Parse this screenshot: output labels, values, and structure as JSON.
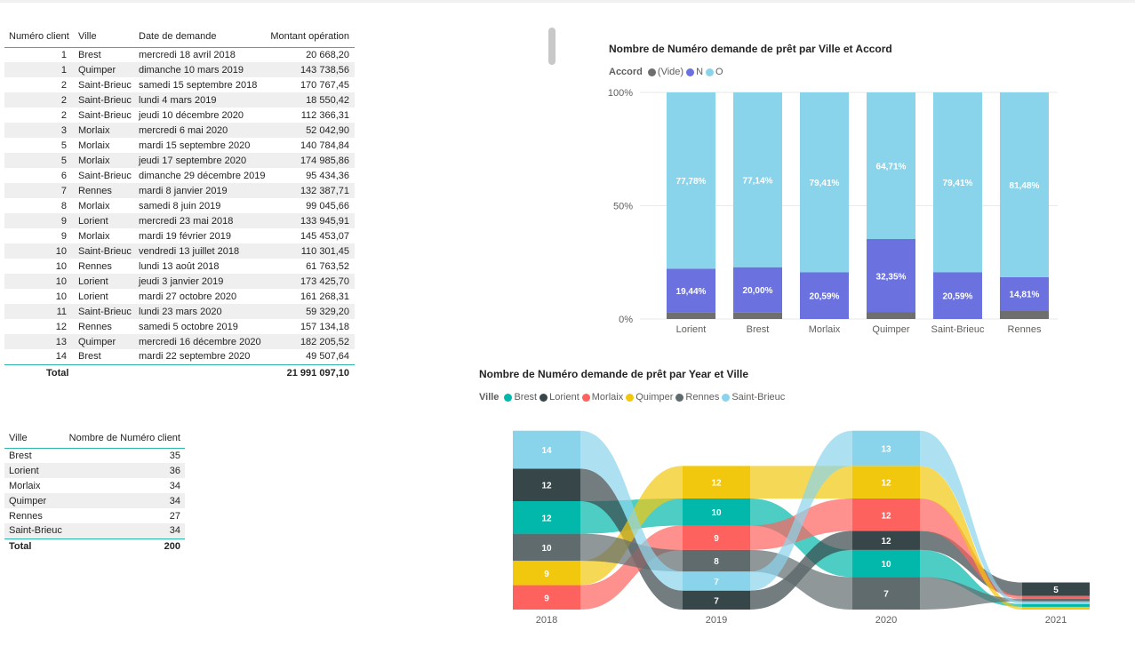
{
  "loans_table": {
    "headers": [
      "Numéro client",
      "Ville",
      "Date de demande",
      "Montant opération"
    ],
    "rows": [
      [
        "1",
        "Brest",
        "mercredi 18 avril 2018",
        "20 668,20"
      ],
      [
        "1",
        "Quimper",
        "dimanche 10 mars 2019",
        "143 738,56"
      ],
      [
        "2",
        "Saint-Brieuc",
        "samedi 15 septembre 2018",
        "170 767,45"
      ],
      [
        "2",
        "Saint-Brieuc",
        "lundi 4 mars 2019",
        "18 550,42"
      ],
      [
        "2",
        "Saint-Brieuc",
        "jeudi 10 décembre 2020",
        "112 366,31"
      ],
      [
        "3",
        "Morlaix",
        "mercredi 6 mai 2020",
        "52 042,90"
      ],
      [
        "5",
        "Morlaix",
        "mardi 15 septembre 2020",
        "140 784,84"
      ],
      [
        "5",
        "Morlaix",
        "jeudi 17 septembre 2020",
        "174 985,86"
      ],
      [
        "6",
        "Saint-Brieuc",
        "dimanche 29 décembre 2019",
        "95 434,36"
      ],
      [
        "7",
        "Rennes",
        "mardi 8 janvier 2019",
        "132 387,71"
      ],
      [
        "8",
        "Morlaix",
        "samedi 8 juin 2019",
        "99 045,66"
      ],
      [
        "9",
        "Lorient",
        "mercredi 23 mai 2018",
        "133 945,91"
      ],
      [
        "9",
        "Morlaix",
        "mardi 19 février 2019",
        "145 453,07"
      ],
      [
        "10",
        "Saint-Brieuc",
        "vendredi 13 juillet 2018",
        "110 301,45"
      ],
      [
        "10",
        "Rennes",
        "lundi 13 août 2018",
        "61 763,52"
      ],
      [
        "10",
        "Lorient",
        "jeudi 3 janvier 2019",
        "173 425,70"
      ],
      [
        "10",
        "Lorient",
        "mardi 27 octobre 2020",
        "161 268,31"
      ],
      [
        "11",
        "Saint-Brieuc",
        "lundi 23 mars 2020",
        "59 329,20"
      ],
      [
        "12",
        "Rennes",
        "samedi 5 octobre 2019",
        "157 134,18"
      ],
      [
        "13",
        "Quimper",
        "mercredi 16 décembre 2020",
        "182 205,52"
      ],
      [
        "14",
        "Brest",
        "mardi 22 septembre 2020",
        "49 507,64"
      ]
    ],
    "total_label": "Total",
    "total_value": "21 991 097,10"
  },
  "ville_table": {
    "headers": [
      "Ville",
      "Nombre de Numéro client"
    ],
    "rows": [
      [
        "Brest",
        "35"
      ],
      [
        "Lorient",
        "36"
      ],
      [
        "Morlaix",
        "34"
      ],
      [
        "Quimper",
        "34"
      ],
      [
        "Rennes",
        "27"
      ],
      [
        "Saint-Brieuc",
        "34"
      ]
    ],
    "total_label": "Total",
    "total_value": "200"
  },
  "bar_chart": {
    "title": "Nombre de Numéro demande de prêt par Ville et Accord",
    "legend_title": "Accord",
    "legend": [
      {
        "label": "(Vide)",
        "color": "#6e6e6e"
      },
      {
        "label": "N",
        "color": "#6b72e0"
      },
      {
        "label": "O",
        "color": "#8ad4eb"
      }
    ],
    "y_ticks": [
      "100%",
      "50%",
      "0%"
    ]
  },
  "ribbon_chart": {
    "title": "Nombre de Numéro demande de prêt par Year et Ville",
    "legend_title": "Ville",
    "legend": [
      {
        "label": "Brest",
        "color": "#01b8aa"
      },
      {
        "label": "Lorient",
        "color": "#374649"
      },
      {
        "label": "Morlaix",
        "color": "#fd625e"
      },
      {
        "label": "Quimper",
        "color": "#f2c80f"
      },
      {
        "label": "Rennes",
        "color": "#5f6b6d"
      },
      {
        "label": "Saint-Brieuc",
        "color": "#8ad4eb"
      }
    ]
  },
  "chart_data": [
    {
      "type": "bar",
      "stacked": "100%",
      "title": "Nombre de Numéro demande de prêt par Ville et Accord",
      "categories": [
        "Lorient",
        "Brest",
        "Morlaix",
        "Quimper",
        "Saint-Brieuc",
        "Rennes"
      ],
      "series": [
        {
          "name": "(Vide)",
          "values": [
            2.78,
            2.86,
            0,
            2.94,
            0,
            3.7
          ]
        },
        {
          "name": "N",
          "values": [
            19.44,
            20.0,
            20.59,
            32.35,
            20.59,
            14.81
          ]
        },
        {
          "name": "O",
          "values": [
            77.78,
            77.14,
            79.41,
            64.71,
            79.41,
            81.48
          ]
        }
      ],
      "data_labels": {
        "N": [
          "19,44%",
          "20,00%",
          "20,59%",
          "32,35%",
          "20,59%",
          "14,81%"
        ],
        "O": [
          "77,78%",
          "77,14%",
          "79,41%",
          "64,71%",
          "79,41%",
          "81,48%"
        ]
      },
      "ylim": [
        0,
        100
      ],
      "legend_position": "top-left",
      "grid": true
    },
    {
      "type": "area",
      "subtype": "ribbon",
      "title": "Nombre de Numéro demande de prêt par Year et Ville",
      "categories": [
        "2018",
        "2019",
        "2020",
        "2021"
      ],
      "series": [
        {
          "name": "Brest",
          "values": [
            12,
            10,
            10,
            1
          ]
        },
        {
          "name": "Lorient",
          "values": [
            12,
            7,
            7,
            5
          ]
        },
        {
          "name": "Morlaix",
          "values": [
            9,
            9,
            12,
            1
          ]
        },
        {
          "name": "Quimper",
          "values": [
            9,
            12,
            12,
            1
          ]
        },
        {
          "name": "Rennes",
          "values": [
            10,
            8,
            12,
            1
          ]
        },
        {
          "name": "Saint-Brieuc",
          "values": [
            14,
            7,
            13,
            1
          ]
        }
      ],
      "stack_order_bottom_to_top": [
        [
          "Morlaix",
          "Quimper",
          "Rennes",
          "Brest",
          "Lorient",
          "Saint-Brieuc"
        ],
        [
          "Lorient",
          "Saint-Brieuc",
          "Rennes",
          "Morlaix",
          "Brest",
          "Quimper"
        ],
        [
          "Rennes",
          "Brest",
          "Lorient",
          "Morlaix",
          "Quimper",
          "Saint-Brieuc"
        ],
        [
          "Quimper",
          "Brest",
          "Saint-Brieuc",
          "Rennes",
          "Morlaix",
          "Lorient"
        ]
      ],
      "labeled_values": {
        "2018": {
          "Saint-Brieuc": "14",
          "Lorient": "12",
          "Brest": "12",
          "Rennes": "10",
          "Quimper": "9",
          "Morlaix": "9"
        },
        "2019": {
          "Quimper": "12",
          "Brest": "10",
          "Morlaix": "9",
          "Rennes": "8",
          "Saint-Brieuc": "7",
          "Lorient": "7"
        },
        "2020": {
          "Saint-Brieuc": "13",
          "Quimper": "12",
          "Morlaix": "12",
          "Lorient": "12",
          "Brest": "10",
          "Rennes": "7"
        },
        "2021": {
          "Lorient": "5"
        }
      },
      "legend_position": "top-left"
    }
  ]
}
